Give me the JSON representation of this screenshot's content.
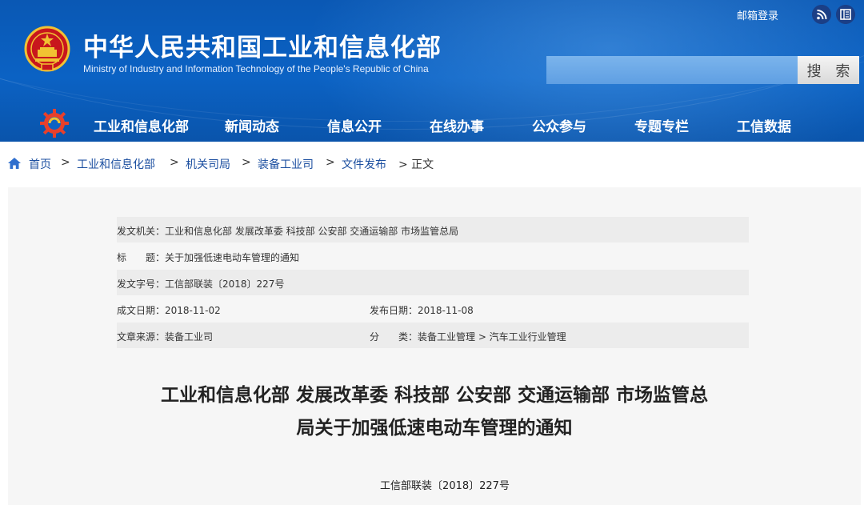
{
  "header": {
    "title": "中华人民共和国工业和信息化部",
    "subtitle": "Ministry of Industry and Information Technology of the People's Republic of China",
    "mail_login": "邮箱登录",
    "rss_icon": "rss-icon",
    "doc_icon": "document-icon",
    "search": {
      "placeholder": "",
      "button_label": "搜 索"
    },
    "nav": [
      "工业和信息化部",
      "新闻动态",
      "信息公开",
      "在线办事",
      "公众参与",
      "专题专栏",
      "工信数据"
    ]
  },
  "breadcrumb": {
    "items": [
      "首页",
      "工业和信息化部",
      "机关司局",
      "装备工业司",
      "文件发布"
    ],
    "current": "正文",
    "separator": ">",
    "separator_last": "> 正文"
  },
  "meta": {
    "issuer": "发文机关：工业和信息化部 发展改革委 科技部 公安部 交通运输部 市场监管总局",
    "title": "标　　题：关于加强低速电动车管理的通知",
    "doc_no": "发文字号：工信部联装〔2018〕227号",
    "created": "成文日期：2018-11-02",
    "published": "发布日期：2018-11-08",
    "source": "文章来源：装备工业司",
    "category": "分　　类：装备工业管理 > 汽车工业行业管理"
  },
  "article": {
    "title_line1": "工业和信息化部 发展改革委 科技部 公安部 交通运输部 市场监管总",
    "title_line2": "局关于加强低速电动车管理的通知",
    "doc_number": "工信部联装〔2018〕227号"
  },
  "colors": {
    "header_blue": "#0b62c4",
    "link_blue": "#1c4fa0",
    "emblem_red": "#c8161d",
    "emblem_gold": "#f1c232"
  }
}
